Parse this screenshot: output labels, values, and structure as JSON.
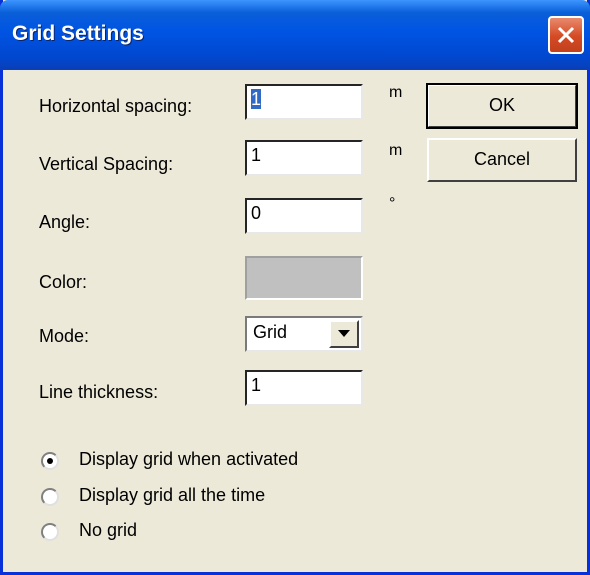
{
  "window": {
    "title": "Grid Settings"
  },
  "fields": {
    "horizontal_spacing": {
      "label": "Horizontal spacing:",
      "value": "1",
      "unit": "m"
    },
    "vertical_spacing": {
      "label": "Vertical Spacing:",
      "value": "1",
      "unit": "m"
    },
    "angle": {
      "label": "Angle:",
      "value": "0",
      "unit": "°"
    },
    "color": {
      "label": "Color:",
      "swatch": "#c0c0c0"
    },
    "mode": {
      "label": "Mode:",
      "selected": "Grid"
    },
    "line_thickness": {
      "label": "Line thickness:",
      "value": "1"
    }
  },
  "buttons": {
    "ok": "OK",
    "cancel": "Cancel"
  },
  "display_options": [
    {
      "label": "Display grid when activated",
      "checked": true
    },
    {
      "label": "Display grid all the time",
      "checked": false
    },
    {
      "label": "No grid",
      "checked": false
    }
  ]
}
